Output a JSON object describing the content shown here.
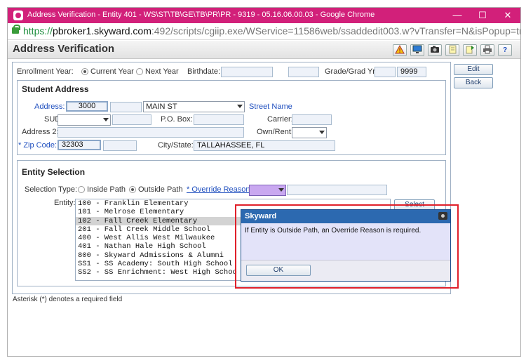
{
  "window": {
    "title": "Address Verification - Entity 401 - WS\\ST\\TB\\GE\\TB\\PR\\PR - 9319 - 05.16.06.00.03 - Google Chrome",
    "minimize": "—",
    "maximize": "☐",
    "close": "✕"
  },
  "browser": {
    "url_scheme": "https://",
    "url_host": "pbroker1.skyward.com",
    "url_path": ":492/scripts/cgiip.exe/WService=11586web/ssaddedit003.w?vTransfer=N&isPopup=true"
  },
  "page": {
    "title": "Address Verification",
    "toolbar_icons": [
      "alert-icon",
      "monitor-icon",
      "camera-icon",
      "notes-icon",
      "refresh-icon",
      "copy-icon",
      "print-icon",
      "help-icon"
    ],
    "help_label": "?"
  },
  "top": {
    "enrollment_year_label": "Enrollment Year:",
    "current_year": "Current Year",
    "next_year": "Next Year",
    "birthdate_label": "Birthdate:",
    "birthdate_value": "",
    "grade_label": "Grade/Grad Yr:",
    "grade_value": "",
    "grad_yr_value": "9999"
  },
  "side_buttons": {
    "edit": "Edit",
    "back": "Back"
  },
  "student_address": {
    "title": "Student Address",
    "address_label": "Address:",
    "address_number": "3000",
    "street": "MAIN ST",
    "street_name_label": "Street Name",
    "sud_label": "SUD:",
    "po_box_label": "P.O. Box:",
    "carrier_label": "Carrier:",
    "address2_label": "Address 2:",
    "own_rent_label": "Own/Rent:",
    "zip_label": "* Zip Code:",
    "zip_value": "32303",
    "city_state_label": "City/State:",
    "city_state_value": "TALLAHASSEE, FL"
  },
  "entity_selection": {
    "title": "Entity Selection",
    "selection_type_label": "Selection Type:",
    "inside_path": "Inside Path",
    "outside_path": "Outside Path",
    "override_label": "* Override Reason:",
    "entity_label": "Entity:",
    "select_button": "Select",
    "entities": [
      "100 - Franklin Elementary",
      "101 - Melrose Elementary",
      "102 - Fall Creek Elementary",
      "201 - Fall Creek Middle School",
      "400 - West Allis West Milwaukee",
      "401 - Nathan Hale High School",
      "800 - Skyward Admissions & Alumni",
      "SS1 - SS Academy: South High School",
      "SS2 - SS Enrichment: West High Schoo"
    ],
    "selected_index": 2
  },
  "footer_note": "Asterisk (*) denotes a required field",
  "dialog": {
    "title": "Skyward",
    "message": "If Entity is Outside Path, an Override Reason is required.",
    "ok": "OK"
  },
  "colors": {
    "titlebar": "#d2207a",
    "dialog_header": "#2c69b0",
    "highlight_outline": "#e0202a",
    "override_field": "#c9a8f0"
  }
}
